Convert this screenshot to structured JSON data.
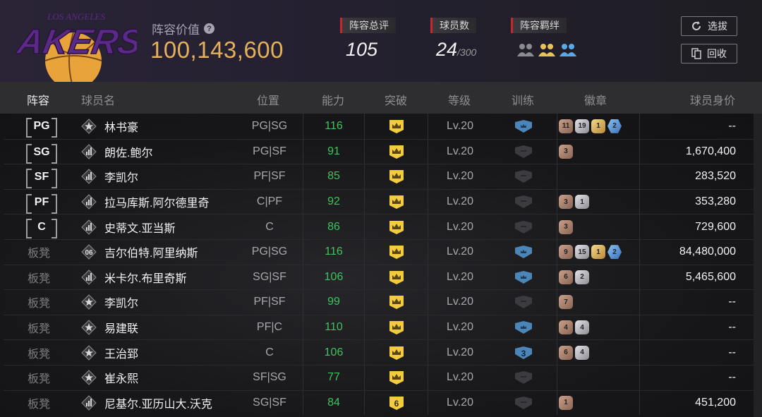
{
  "team": {
    "logo_text": "LAKERS",
    "logo_top_text": "LOS ANGELES"
  },
  "header": {
    "value_label": "阵容价值",
    "value_number": "100,143,600",
    "overall_label": "阵容总评",
    "overall_value": "105",
    "count_label": "球员数",
    "count_value": "24",
    "count_max": "/300",
    "bond_label": "阵容羁绊",
    "bond_icons": [
      "bond-gray-icon",
      "bond-gold-icon",
      "bond-blue-icon"
    ],
    "select_label": "选拔",
    "recycle_label": "回收"
  },
  "columns": {
    "lineup": "阵容",
    "name": "球员名",
    "position": "位置",
    "rating": "能力",
    "breakthrough": "突破",
    "level": "等级",
    "training": "训练",
    "badges": "徽章",
    "price": "球员身价"
  },
  "rows": [
    {
      "slot": "PG",
      "starter": true,
      "class_icon": "star-icon",
      "name": "林书豪",
      "position": "PG|SG",
      "rating": "116",
      "break": "crown",
      "level": "Lv.20",
      "train": "blue",
      "train_num": "",
      "badges": [
        {
          "t": "bronze",
          "v": "11"
        },
        {
          "t": "silver",
          "v": "19"
        },
        {
          "t": "gold",
          "v": "1"
        },
        {
          "t": "blue",
          "v": "2"
        }
      ],
      "price": "--"
    },
    {
      "slot": "SG",
      "starter": true,
      "class_icon": "bars-icon",
      "name": "朗佐.鲍尔",
      "position": "PG|SF",
      "rating": "91",
      "break": "crown",
      "level": "Lv.20",
      "train": "gray",
      "train_num": "",
      "badges": [
        {
          "t": "bronze",
          "v": "3"
        }
      ],
      "price": "1,670,400"
    },
    {
      "slot": "SF",
      "starter": true,
      "class_icon": "bars-icon",
      "name": "李凯尔",
      "position": "PF|SF",
      "rating": "85",
      "break": "crown",
      "level": "Lv.20",
      "train": "gray",
      "train_num": "",
      "badges": [],
      "price": "283,520"
    },
    {
      "slot": "PF",
      "starter": true,
      "class_icon": "bars-icon",
      "name": "拉马库斯.阿尔德里奇",
      "position": "C|PF",
      "rating": "92",
      "break": "crown",
      "level": "Lv.20",
      "train": "gray",
      "train_num": "",
      "badges": [
        {
          "t": "bronze",
          "v": "3"
        },
        {
          "t": "silver",
          "v": "1"
        }
      ],
      "price": "353,280"
    },
    {
      "slot": "C",
      "starter": true,
      "class_icon": "bars-icon",
      "name": "史蒂文.亚当斯",
      "position": "C",
      "rating": "86",
      "break": "crown",
      "level": "Lv.20",
      "train": "gray",
      "train_num": "",
      "badges": [
        {
          "t": "bronze",
          "v": "3"
        }
      ],
      "price": "729,600"
    },
    {
      "slot": "板凳",
      "starter": false,
      "class_icon": "number-icon",
      "class_num": "06",
      "name": "吉尔伯特.阿里纳斯",
      "position": "PG|SG",
      "rating": "116",
      "break": "crown",
      "level": "Lv.20",
      "train": "blue",
      "train_num": "",
      "badges": [
        {
          "t": "bronze",
          "v": "9"
        },
        {
          "t": "silver",
          "v": "15"
        },
        {
          "t": "gold",
          "v": "1"
        },
        {
          "t": "blue",
          "v": "2"
        }
      ],
      "price": "84,480,000"
    },
    {
      "slot": "板凳",
      "starter": false,
      "class_icon": "bars-icon",
      "name": "米卡尔.布里奇斯",
      "position": "SG|SF",
      "rating": "106",
      "break": "crown",
      "level": "Lv.20",
      "train": "blue",
      "train_num": "",
      "badges": [
        {
          "t": "bronze",
          "v": "6"
        },
        {
          "t": "silver",
          "v": "2"
        }
      ],
      "price": "5,465,600"
    },
    {
      "slot": "板凳",
      "starter": false,
      "class_icon": "star-icon",
      "name": "李凯尔",
      "position": "PF|SF",
      "rating": "99",
      "break": "crown",
      "level": "Lv.20",
      "train": "gray",
      "train_num": "",
      "badges": [
        {
          "t": "bronze",
          "v": "7"
        }
      ],
      "price": "--"
    },
    {
      "slot": "板凳",
      "starter": false,
      "class_icon": "star-icon",
      "name": "易建联",
      "position": "PF|C",
      "rating": "110",
      "break": "crown",
      "level": "Lv.20",
      "train": "blue",
      "train_num": "",
      "badges": [
        {
          "t": "bronze",
          "v": "4"
        },
        {
          "t": "silver",
          "v": "4"
        }
      ],
      "price": "--"
    },
    {
      "slot": "板凳",
      "starter": false,
      "class_icon": "star-icon",
      "name": "王治郅",
      "position": "C",
      "rating": "106",
      "break": "crown",
      "level": "Lv.20",
      "train": "blue",
      "train_num": "3",
      "badges": [
        {
          "t": "bronze",
          "v": "6"
        },
        {
          "t": "silver",
          "v": "4"
        }
      ],
      "price": "--"
    },
    {
      "slot": "板凳",
      "starter": false,
      "class_icon": "star-icon",
      "name": "崔永熙",
      "position": "SF|SG",
      "rating": "77",
      "break": "crown",
      "level": "Lv.20",
      "train": "gray",
      "train_num": "",
      "badges": [],
      "price": "--"
    },
    {
      "slot": "板凳",
      "starter": false,
      "class_icon": "bars-icon",
      "name": "尼基尔.亚历山大.沃克",
      "position": "SG|SF",
      "rating": "84",
      "break": "6",
      "level": "Lv.20",
      "train": "gray",
      "train_num": "",
      "badges": [
        {
          "t": "bronze",
          "v": "1"
        }
      ],
      "price": "451,200"
    }
  ]
}
